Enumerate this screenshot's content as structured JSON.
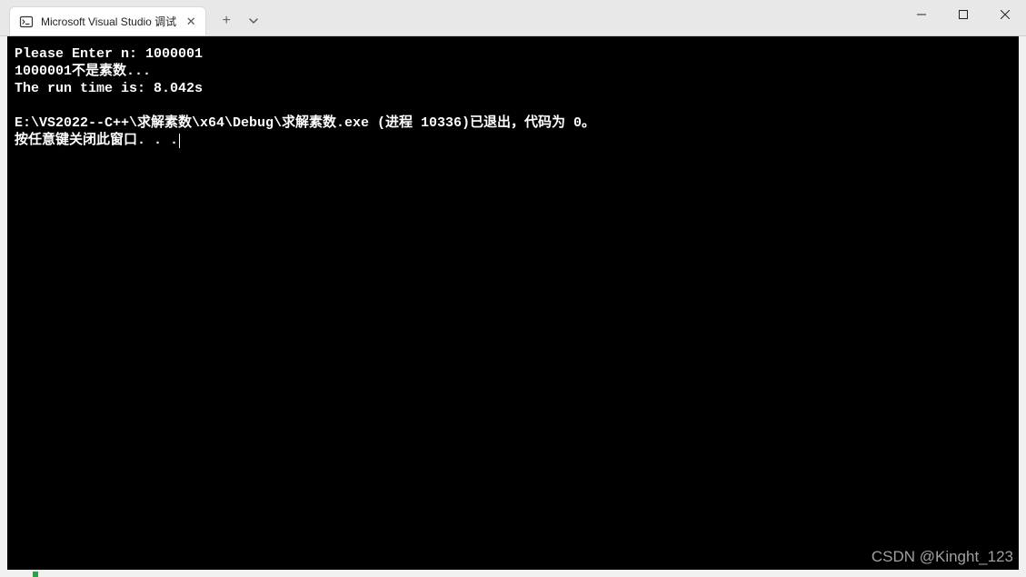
{
  "titlebar": {
    "tab": {
      "title": "Microsoft Visual Studio 调试"
    },
    "new_tab": "+",
    "dropdown_glyph": "⌄",
    "minimize_glyph": "—",
    "maximize_glyph": "☐",
    "close_glyph": "✕",
    "tab_close_glyph": "✕"
  },
  "console": {
    "lines": [
      "Please Enter n: 1000001",
      "1000001不是素数...",
      "The run time is: 8.042s",
      "",
      "E:\\VS2022--C++\\求解素数\\x64\\Debug\\求解素数.exe (进程 10336)已退出，代码为 0。",
      "按任意键关闭此窗口. . ."
    ]
  },
  "watermark": "CSDN @Kinght_123"
}
